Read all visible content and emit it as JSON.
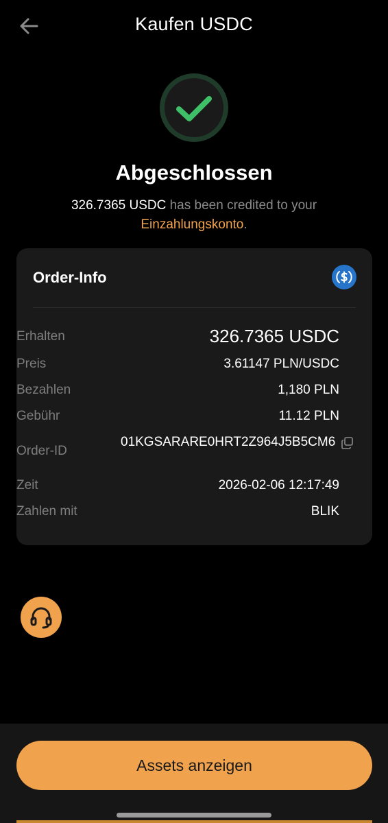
{
  "header": {
    "title": "Kaufen USDC",
    "back_icon": "arrow-left-icon"
  },
  "status": {
    "icon": "checkmark-icon",
    "title": "Abgeschlossen",
    "msg_amount": "326.7365 USDC",
    "msg_middle": " has been credited to your ",
    "msg_account": "Einzahlungskonto",
    "msg_end": "."
  },
  "order_info": {
    "title": "Order-Info",
    "coin_icon": "usdc-icon",
    "rows": [
      {
        "label": "Erhalten",
        "value": "326.7365 USDC"
      },
      {
        "label": "Preis",
        "value": "3.61147 PLN/USDC"
      },
      {
        "label": "Bezahlen",
        "value": "1,180 PLN"
      },
      {
        "label": "Gebühr",
        "value": "11.12 PLN"
      },
      {
        "label": "Order-ID",
        "value": "01KGSARARE0HRT2Z964J5B5CM6"
      },
      {
        "label": "Zeit",
        "value": "2026-02-06 12:17:49"
      },
      {
        "label": "Zahlen mit",
        "value": "BLIK"
      }
    ]
  },
  "support": {
    "icon": "headset-icon"
  },
  "footer": {
    "button_label": "Assets anzeigen"
  },
  "colors": {
    "accent": "#f0a24d",
    "success": "#3fbf67",
    "card_bg": "#1a1a1a",
    "muted_text": "#7e7e7e"
  }
}
